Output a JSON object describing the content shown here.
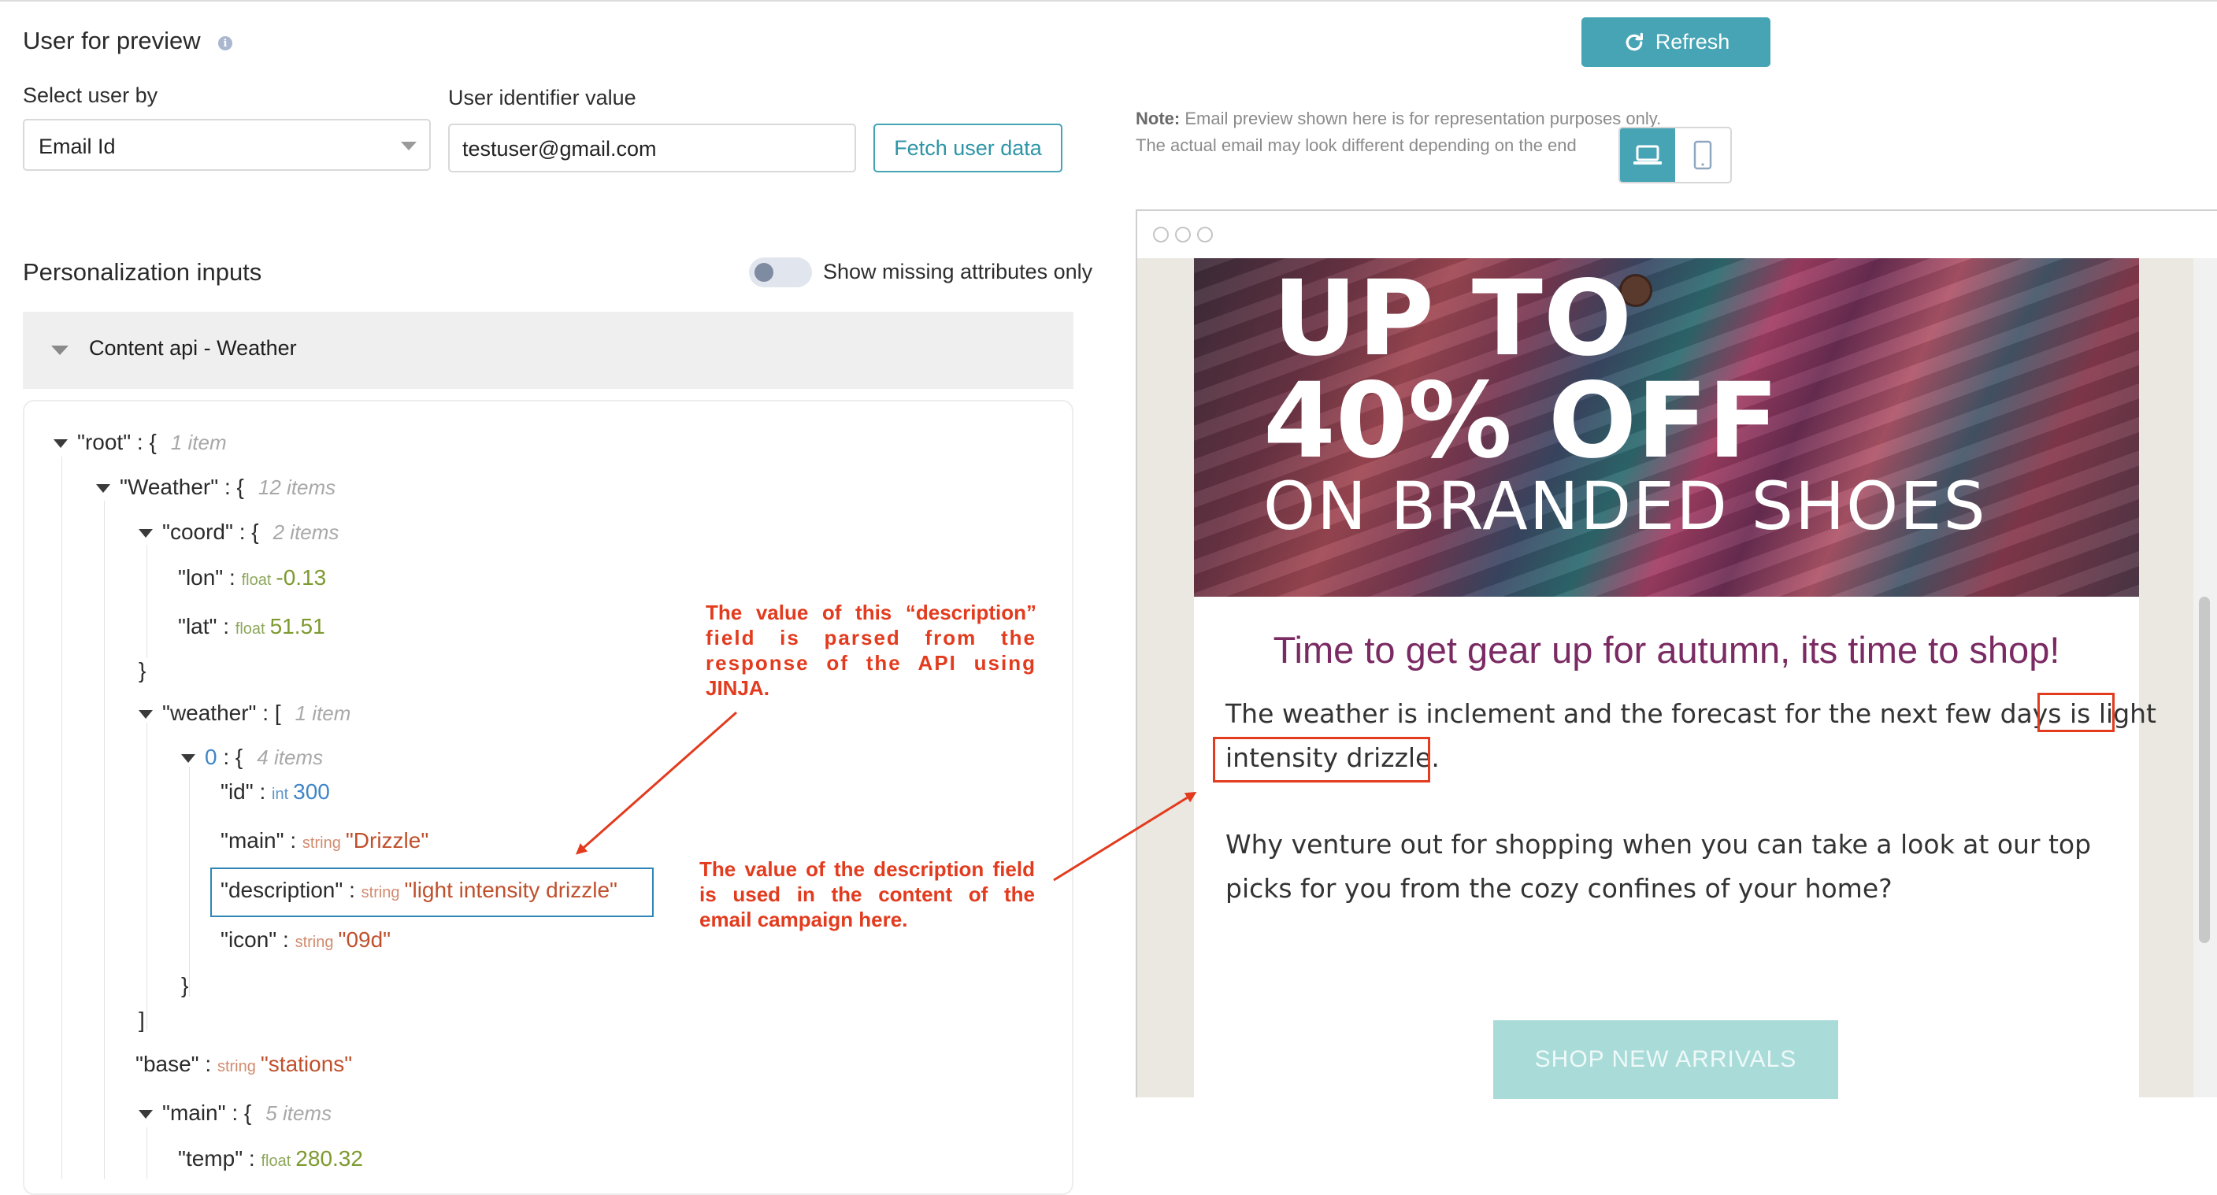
{
  "left": {
    "user_preview_title": "User for preview",
    "select_user_label": "Select user by",
    "select_user_value": "Email Id",
    "user_id_label": "User identifier value",
    "user_id_value": "testuser@gmail.com",
    "fetch_button": "Fetch user data",
    "personalization_title": "Personalization inputs",
    "toggle_label": "Show missing attributes only",
    "accordion_title": "Content api - Weather",
    "tree": {
      "root_key": "\"root\"",
      "root_count": "1 item",
      "weather_key": "\"Weather\"",
      "weather_count": "12 items",
      "coord_key": "\"coord\"",
      "coord_count": "2 items",
      "lon_key": "\"lon\"",
      "lon_type": "float",
      "lon_value": "-0.13",
      "lat_key": "\"lat\"",
      "lat_type": "float",
      "lat_value": "51.51",
      "weather_arr_key": "\"weather\"",
      "weather_arr_count": "1 item",
      "idx0_key": "0",
      "idx0_count": "4 items",
      "id_key": "\"id\"",
      "id_type": "int",
      "id_value": "300",
      "main_key": "\"main\"",
      "main_type": "string",
      "main_value": "\"Drizzle\"",
      "description_key": "\"description\"",
      "description_type": "string",
      "description_value": "\"light intensity drizzle\"",
      "icon_key": "\"icon\"",
      "icon_type": "string",
      "icon_value": "\"09d\"",
      "base_key": "\"base\"",
      "base_type": "string",
      "base_value": "\"stations\"",
      "main_obj_key": "\"main\"",
      "main_obj_count": "5 items",
      "temp_key": "\"temp\"",
      "temp_type": "float",
      "temp_value": "280.32"
    },
    "annotation_1": [
      "The value of this “description”",
      "field is parsed from the",
      "response of the API using",
      "JINJA."
    ],
    "annotation_2": [
      "The value of the description field",
      "is used in the content of the",
      "email campaign here."
    ]
  },
  "right": {
    "refresh_button": "Refresh",
    "note_bold": "Note:",
    "note_line1": "Email preview shown here is for representation purposes only.",
    "note_line2": "The actual email may look different depending on the end",
    "email": {
      "hero_line1": "UP TO",
      "hero_line2": "40% OFF",
      "hero_line3": "ON BRANDED SHOES",
      "headline": "Time to get gear up for autumn, its time to shop!",
      "para1_a": "The weather is inclement and the forecast for the next few days is",
      "para1_hl1": "light",
      "para1_hl2": "intensity drizzle",
      "para1_end": ".",
      "para2_line1": "Why venture out for shopping when you can take a look at our top",
      "para2_line2": "picks for you from the cozy confines of your home?",
      "cta": "SHOP NEW ARRIVALS"
    }
  },
  "colors": {
    "accent": "#46a4b5",
    "annotation_red": "#e23b1e",
    "headline_purple": "#7b2b63",
    "cta_bg": "#a9dcd9"
  }
}
